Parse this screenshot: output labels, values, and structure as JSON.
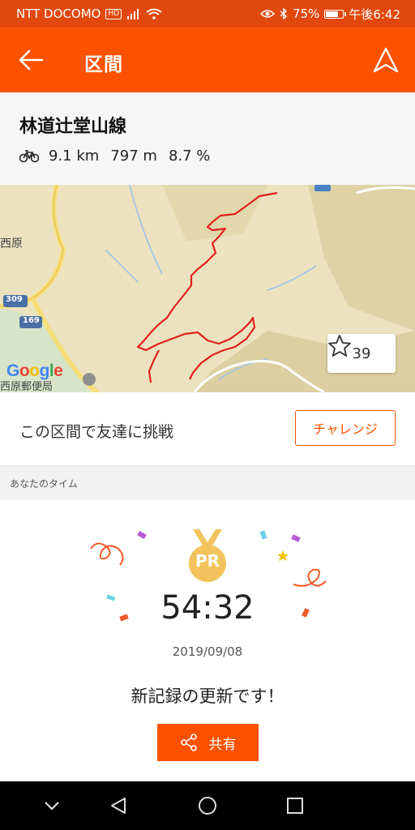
{
  "status_bar": {
    "carrier": "NTT DOCOMO",
    "hd": "HD",
    "battery": "75%",
    "battery_level": 0.75,
    "time": "午後6:42"
  },
  "app_bar": {
    "title": "区間",
    "back_icon": "arrow-left-icon",
    "nav_icon": "navigation-icon"
  },
  "segment": {
    "name": "林道辻堂山線",
    "sport_icon": "bicycle-icon",
    "distance": "9.1 km",
    "elevation": "797 m",
    "grade": "8.7 %"
  },
  "map": {
    "labels": {
      "place1": "西原",
      "route309": "309",
      "route169": "169",
      "post_office": "西原郵便局"
    },
    "star_count": "39",
    "google": "Google"
  },
  "challenge": {
    "text": "この区間で友達に挑戦",
    "button": "チャレンジ"
  },
  "your_time": {
    "section_label": "あなたのタイム",
    "badge": "PR",
    "time": "54:32",
    "date": "2019/09/08",
    "message": "新記録の更新です！",
    "share_label": "共有"
  },
  "colors": {
    "brand": "#fc5200",
    "status_bar": "#e0480e",
    "route": "#e0201c",
    "medal": "#f2c35c"
  }
}
